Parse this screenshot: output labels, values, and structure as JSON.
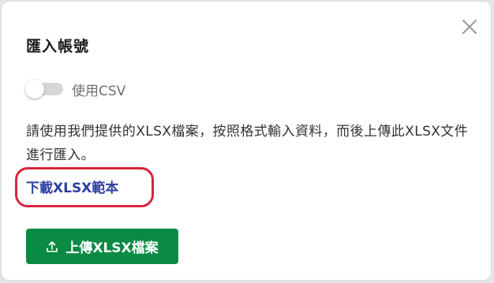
{
  "dialog": {
    "title": "匯入帳號",
    "close_icon": "close-icon",
    "toggle": {
      "label": "使用CSV",
      "checked": false
    },
    "description": "請使用我們提供的XLSX檔案，按照格式輸入資料，而後上傳此XLSX文件進行匯入。",
    "download_link": "下載XLSX範本",
    "upload_button": {
      "label": "上傳XLSX檔案",
      "icon": "upload-icon"
    }
  },
  "colors": {
    "primary_button": "#0b8a44",
    "link": "#2f3fa3",
    "highlight": "#d7263d"
  }
}
